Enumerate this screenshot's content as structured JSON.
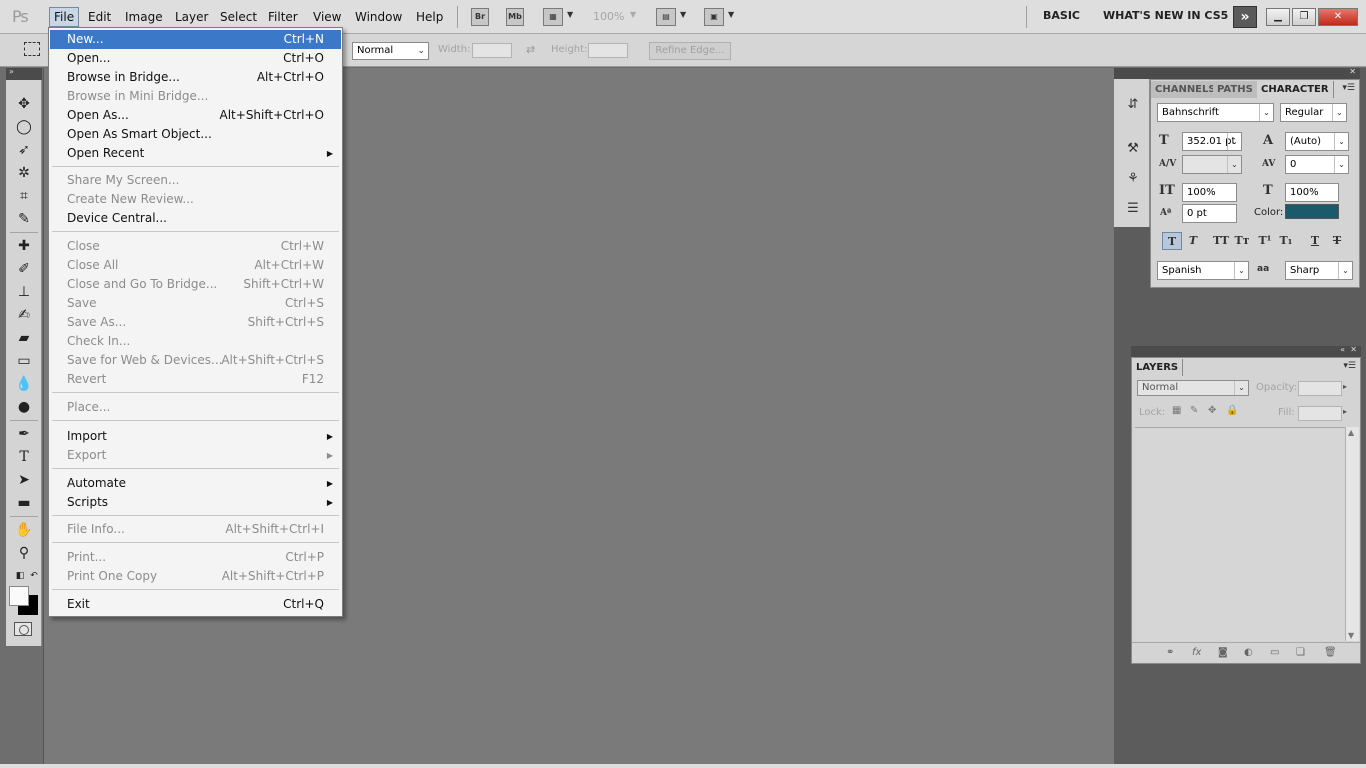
{
  "app": {
    "logo": "Ps",
    "menus": [
      "File",
      "Edit",
      "Image",
      "Layer",
      "Select",
      "Filter",
      "View",
      "Window",
      "Help"
    ],
    "bridge_icon": "Br",
    "minibridge_icon": "Mb",
    "zoom": "100%",
    "workspace_basic": "BASIC",
    "workspace_new": "WHAT'S NEW IN CS5",
    "workspace_more": "»"
  },
  "options_bar": {
    "style_value": "Normal",
    "width_label": "Width:",
    "height_label": "Height:",
    "refine_label": "Refine Edge..."
  },
  "file_menu": {
    "items": [
      {
        "label": "New...",
        "shortcut": "Ctrl+N",
        "state": "highlighted"
      },
      {
        "label": "Open...",
        "shortcut": "Ctrl+O",
        "state": "enabled"
      },
      {
        "label": "Browse in Bridge...",
        "shortcut": "Alt+Ctrl+O",
        "state": "enabled"
      },
      {
        "label": "Browse in Mini Bridge...",
        "shortcut": "",
        "state": "disabled"
      },
      {
        "label": "Open As...",
        "shortcut": "Alt+Shift+Ctrl+O",
        "state": "enabled"
      },
      {
        "label": "Open As Smart Object...",
        "shortcut": "",
        "state": "enabled"
      },
      {
        "label": "Open Recent",
        "shortcut": "",
        "state": "enabled",
        "submenu": true
      },
      {
        "label": "Share My Screen...",
        "shortcut": "",
        "state": "disabled"
      },
      {
        "label": "Create New Review...",
        "shortcut": "",
        "state": "disabled"
      },
      {
        "label": "Device Central...",
        "shortcut": "",
        "state": "enabled"
      },
      {
        "label": "Close",
        "shortcut": "Ctrl+W",
        "state": "disabled"
      },
      {
        "label": "Close All",
        "shortcut": "Alt+Ctrl+W",
        "state": "disabled"
      },
      {
        "label": "Close and Go To Bridge...",
        "shortcut": "Shift+Ctrl+W",
        "state": "disabled"
      },
      {
        "label": "Save",
        "shortcut": "Ctrl+S",
        "state": "disabled"
      },
      {
        "label": "Save As...",
        "shortcut": "Shift+Ctrl+S",
        "state": "disabled"
      },
      {
        "label": "Check In...",
        "shortcut": "",
        "state": "disabled"
      },
      {
        "label": "Save for Web & Devices...",
        "shortcut": "Alt+Shift+Ctrl+S",
        "state": "disabled"
      },
      {
        "label": "Revert",
        "shortcut": "F12",
        "state": "disabled"
      },
      {
        "label": "Place...",
        "shortcut": "",
        "state": "disabled"
      },
      {
        "label": "Import",
        "shortcut": "",
        "state": "enabled",
        "submenu": true
      },
      {
        "label": "Export",
        "shortcut": "",
        "state": "disabled",
        "submenu": true
      },
      {
        "label": "Automate",
        "shortcut": "",
        "state": "enabled",
        "submenu": true
      },
      {
        "label": "Scripts",
        "shortcut": "",
        "state": "enabled",
        "submenu": true
      },
      {
        "label": "File Info...",
        "shortcut": "Alt+Shift+Ctrl+I",
        "state": "disabled"
      },
      {
        "label": "Print...",
        "shortcut": "Ctrl+P",
        "state": "disabled"
      },
      {
        "label": "Print One Copy",
        "shortcut": "Alt+Shift+Ctrl+P",
        "state": "disabled"
      },
      {
        "label": "Exit",
        "shortcut": "Ctrl+Q",
        "state": "enabled"
      }
    ]
  },
  "character_panel": {
    "tabs": [
      "CHANNELS",
      "PATHS",
      "CHARACTER"
    ],
    "font_family": "Bahnschrift",
    "font_style": "Regular",
    "font_size": "352.01 pt",
    "leading": "(Auto)",
    "kerning": "",
    "tracking": "0",
    "vertical_scale": "100%",
    "horizontal_scale": "100%",
    "baseline_shift": "0 pt",
    "color_label": "Color:",
    "color": "#1b5a6b",
    "language": "Spanish",
    "antialias_icon": "aa",
    "antialias": "Sharp",
    "style_buttons": [
      "T",
      "T",
      "TT",
      "Tт",
      "T¹",
      "T₁",
      "T",
      "T"
    ]
  },
  "layers_panel": {
    "title": "LAYERS",
    "blend_mode": "Normal",
    "opacity_label": "Opacity:",
    "lock_label": "Lock:",
    "fill_label": "Fill:"
  }
}
